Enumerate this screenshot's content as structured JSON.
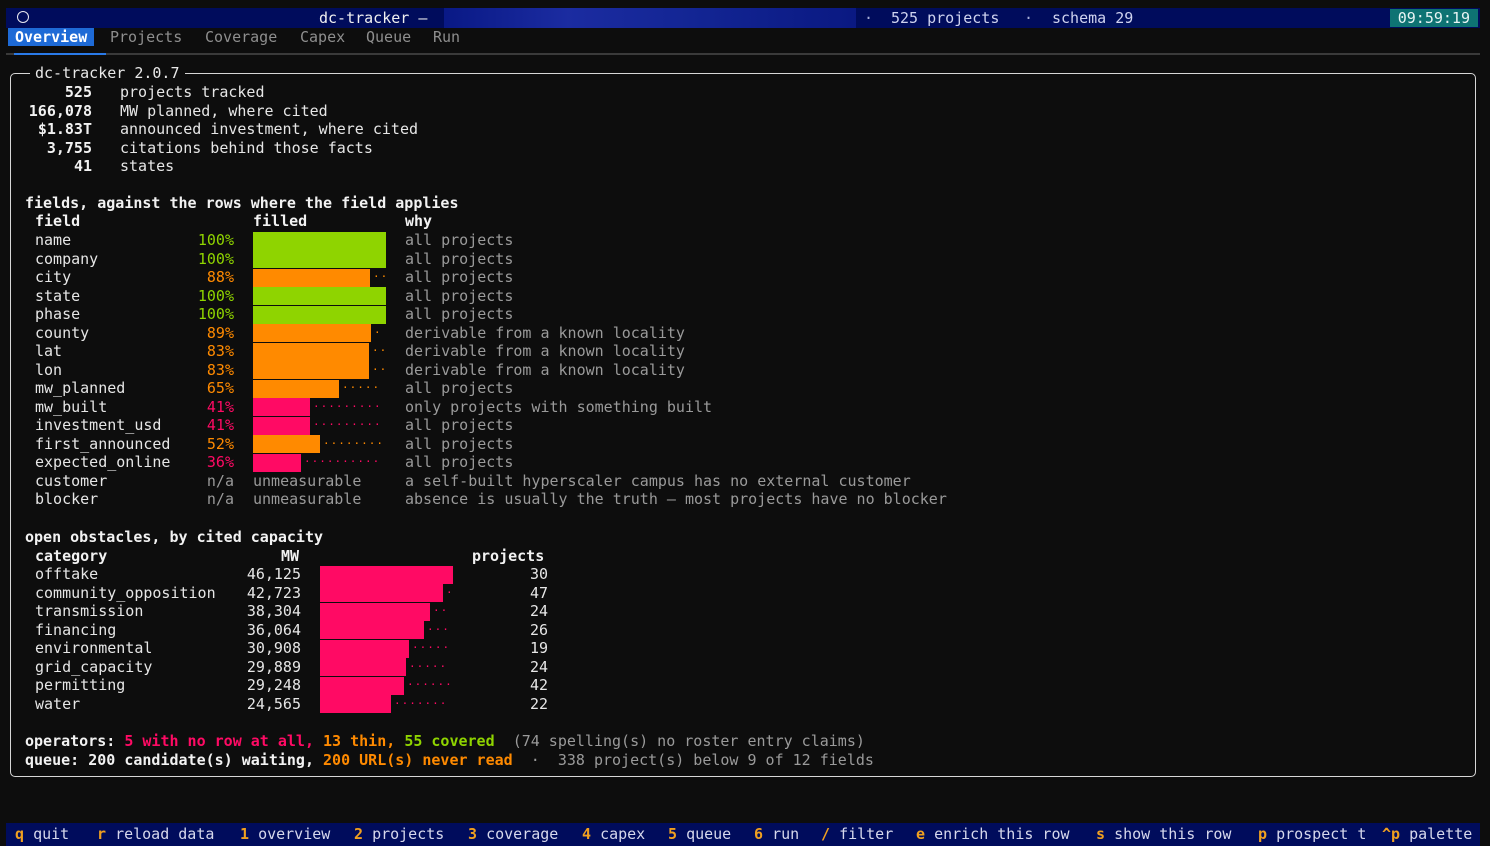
{
  "titlebar": {
    "app": "dc-tracker —",
    "projects": "525 projects",
    "schema": "schema 29",
    "sep": "·",
    "clock": "09:59:19"
  },
  "tabs": [
    "Overview",
    "Projects",
    "Coverage",
    "Capex",
    "Queue",
    "Run"
  ],
  "panel_title": "dc-tracker 2.0.7",
  "summary": [
    {
      "value": "525",
      "label": "projects tracked"
    },
    {
      "value": "166,078",
      "label": "MW planned, where cited"
    },
    {
      "value": "$1.83T",
      "label": "announced investment, where cited"
    },
    {
      "value": "3,755",
      "label": "citations behind those facts"
    },
    {
      "value": "41",
      "label": "states"
    }
  ],
  "fields_section": {
    "heading": "fields, against the rows where the field applies",
    "col_field": "field",
    "col_filled": "filled",
    "col_why": "why",
    "rows": [
      {
        "field": "name",
        "pct": "100%",
        "fill": 1.0,
        "color": "#8fd400",
        "why": "all projects"
      },
      {
        "field": "company",
        "pct": "100%",
        "fill": 1.0,
        "color": "#8fd400",
        "why": "all projects"
      },
      {
        "field": "city",
        "pct": "88%",
        "fill": 0.88,
        "color": "#ff8a00",
        "why": "all projects"
      },
      {
        "field": "state",
        "pct": "100%",
        "fill": 1.0,
        "color": "#8fd400",
        "why": "all projects"
      },
      {
        "field": "phase",
        "pct": "100%",
        "fill": 1.0,
        "color": "#8fd400",
        "why": "all projects"
      },
      {
        "field": "county",
        "pct": "89%",
        "fill": 0.89,
        "color": "#ff8a00",
        "why": "derivable from a known locality"
      },
      {
        "field": "lat",
        "pct": "83%",
        "fill": 0.87,
        "color": "#ff8a00",
        "why": "derivable from a known locality"
      },
      {
        "field": "lon",
        "pct": "83%",
        "fill": 0.87,
        "color": "#ff8a00",
        "why": "derivable from a known locality"
      },
      {
        "field": "mw_planned",
        "pct": "65%",
        "fill": 0.65,
        "color": "#ff8a00",
        "why": "all projects"
      },
      {
        "field": "mw_built",
        "pct": "41%",
        "fill": 0.43,
        "color": "#ff0a64",
        "why": "only projects with something built"
      },
      {
        "field": "investment_usd",
        "pct": "41%",
        "fill": 0.43,
        "color": "#ff0a64",
        "why": "all projects"
      },
      {
        "field": "first_announced",
        "pct": "52%",
        "fill": 0.5,
        "color": "#ff8a00",
        "why": "all projects"
      },
      {
        "field": "expected_online",
        "pct": "36%",
        "fill": 0.36,
        "color": "#ff0a64",
        "why": "all projects"
      },
      {
        "field": "customer",
        "pct": "n/a",
        "fill": null,
        "na": "unmeasurable",
        "why": "a self-built hyperscaler campus has no external customer"
      },
      {
        "field": "blocker",
        "pct": "n/a",
        "fill": null,
        "na": "unmeasurable",
        "why": "absence is usually the truth — most projects have no blocker"
      }
    ]
  },
  "obstacles_section": {
    "heading": "open obstacles, by cited capacity",
    "col_category": "category",
    "col_mw": "MW",
    "col_projects": "projects",
    "rows": [
      {
        "category": "offtake",
        "mw": "46,125",
        "value": 46125,
        "projects": "30"
      },
      {
        "category": "community_opposition",
        "mw": "42,723",
        "value": 42723,
        "projects": "47"
      },
      {
        "category": "transmission",
        "mw": "38,304",
        "value": 38304,
        "projects": "24"
      },
      {
        "category": "financing",
        "mw": "36,064",
        "value": 36064,
        "projects": "26"
      },
      {
        "category": "environmental",
        "mw": "30,908",
        "value": 30908,
        "projects": "19"
      },
      {
        "category": "grid_capacity",
        "mw": "29,889",
        "value": 29889,
        "projects": "24"
      },
      {
        "category": "permitting",
        "mw": "29,248",
        "value": 29248,
        "projects": "42"
      },
      {
        "category": "water",
        "mw": "24,565",
        "value": 24565,
        "projects": "22"
      }
    ],
    "bar_color": "#ff0a64"
  },
  "operators_line": {
    "label": "operators:",
    "no_row": "5 with no row at all,",
    "thin": "13 thin,",
    "covered": "55 covered",
    "spelling": "(74 spelling(s) no roster entry claims)"
  },
  "queue_line": {
    "label": "queue:",
    "waiting": "200 candidate(s) waiting,",
    "never_read": "200 URL(s) never read",
    "dot": "·",
    "below": "338 project(s) below 9 of 12 fields"
  },
  "footer": [
    {
      "key": "q",
      "label": "quit"
    },
    {
      "key": "r",
      "label": "reload data"
    },
    {
      "key": "1",
      "label": "overview"
    },
    {
      "key": "2",
      "label": "projects"
    },
    {
      "key": "3",
      "label": "coverage"
    },
    {
      "key": "4",
      "label": "capex"
    },
    {
      "key": "5",
      "label": "queue"
    },
    {
      "key": "6",
      "label": "run"
    },
    {
      "key": "/",
      "label": "filter"
    },
    {
      "key": "e",
      "label": "enrich this row"
    },
    {
      "key": "s",
      "label": "show this row"
    },
    {
      "key": "p",
      "label": "prospect t"
    },
    {
      "key": "^p",
      "label": "palette"
    }
  ],
  "colors": {
    "green": "#8fd400",
    "orange": "#ff8a00",
    "pink": "#ff0a64",
    "accent": "#1e6ad6",
    "clock_bg": "#0e7373"
  }
}
